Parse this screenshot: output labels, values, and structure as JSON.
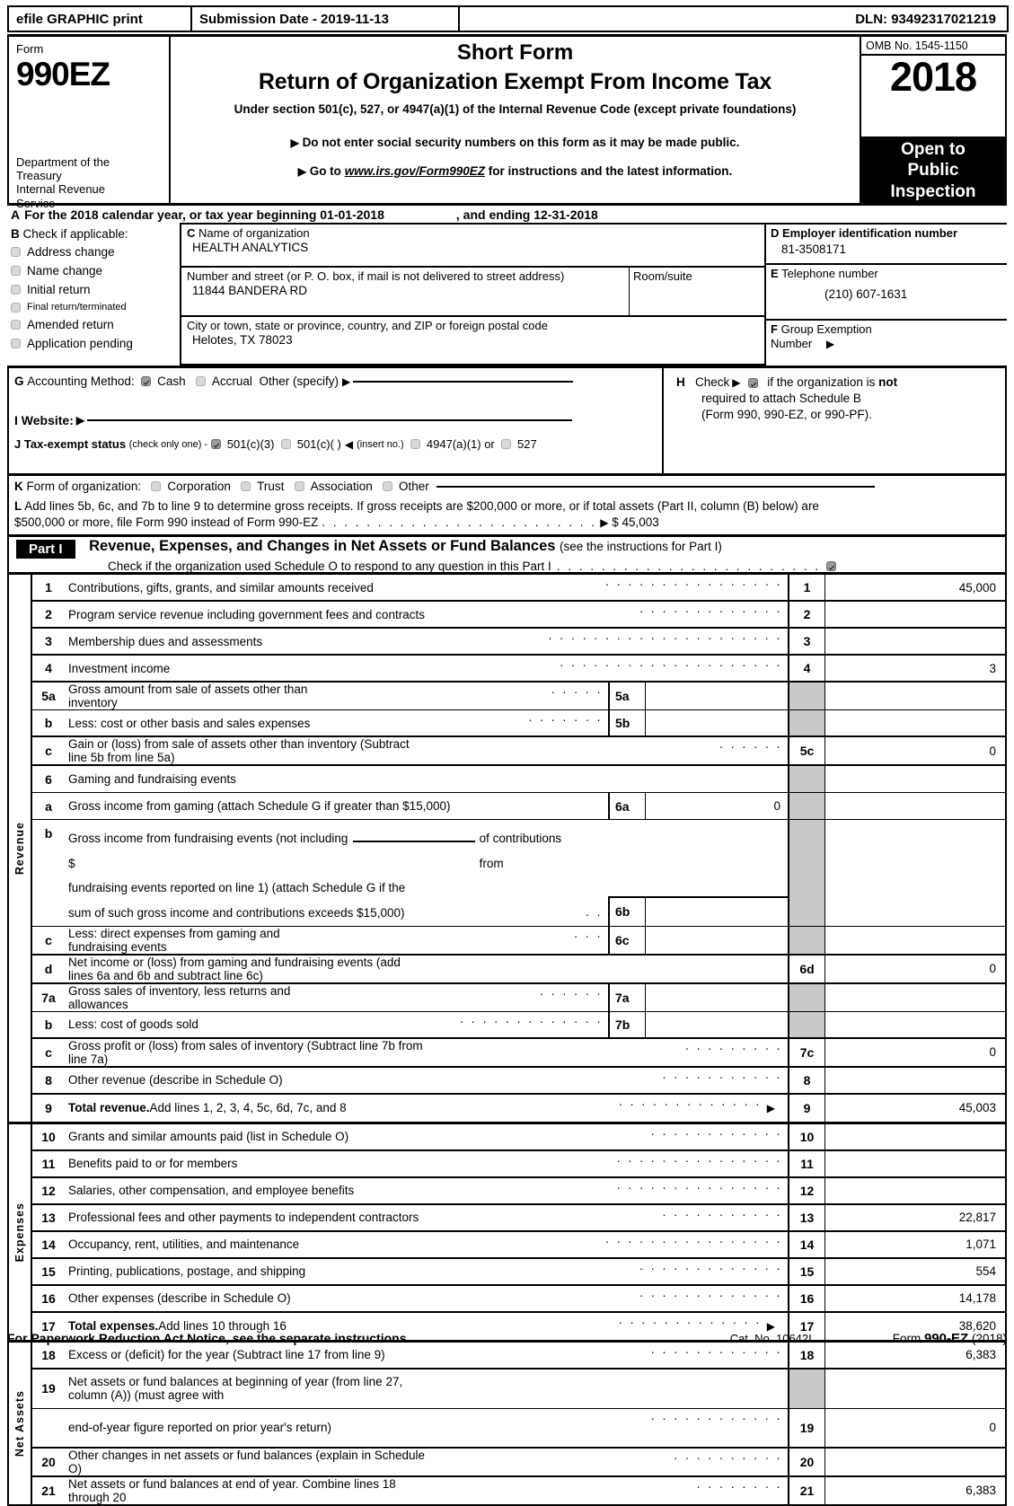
{
  "efile": {
    "graphic_print": "efile GRAPHIC print",
    "submission_date": "Submission Date - 2019-11-13",
    "dln": "DLN: 93492317021219"
  },
  "header": {
    "form_word": "Form",
    "form_number": "990EZ",
    "department": "Department of the Treasury Internal Revenue Service",
    "short_form": "Short Form",
    "title": "Return of Organization Exempt From Income Tax",
    "subtitle": "Under section 501(c), 527, or 4947(a)(1) of the Internal Revenue Code (except private foundations)",
    "note_ssn": "Do not enter social security numbers on this form as it may be made public.",
    "note_goto_prefix": "Go to",
    "note_goto_link": "www.irs.gov/Form990EZ",
    "note_goto_suffix": "for instructions and the latest information.",
    "omb": "OMB No. 1545-1150",
    "year": "2018",
    "open_to": "Open to",
    "public": "Public",
    "inspection": "Inspection"
  },
  "lineA": {
    "letter": "A",
    "text_before": "For the 2018 calendar year, or tax year beginning",
    "begin_date": "01-01-2018",
    "text_middle": ", and ending",
    "end_date": "12-31-2018"
  },
  "blockB": {
    "letter": "B",
    "heading": "Check if applicable:",
    "items": [
      {
        "label": "Address change",
        "checked": false
      },
      {
        "label": "Name change",
        "checked": false
      },
      {
        "label": "Initial return",
        "checked": false
      },
      {
        "label": "Final return/terminated",
        "checked": false
      },
      {
        "label": "Amended return",
        "checked": false
      },
      {
        "label": "Application pending",
        "checked": false
      }
    ]
  },
  "blockC": {
    "letter": "C",
    "name_label": "Name of organization",
    "name_value": "HEALTH ANALYTICS",
    "street_label": "Number and street (or P. O. box, if mail is not delivered to street address)",
    "street_value": "11844 BANDERA RD",
    "room_label": "Room/suite",
    "room_value": "",
    "city_label": "City or town, state or province, country, and ZIP or foreign postal code",
    "city_value": "Helotes, TX   78023"
  },
  "blockD": {
    "ein_letter": "D",
    "ein_label": "Employer identification number",
    "ein_value": "81-3508171",
    "tel_letter": "E",
    "tel_label": "Telephone number",
    "tel_value": "(210) 607-1631",
    "group_letter": "F",
    "group_label_1": "Group Exemption",
    "group_label_2": "Number",
    "group_value": ""
  },
  "lineG": {
    "letter": "G",
    "label": "Accounting Method:",
    "cash": "Cash",
    "cash_checked": true,
    "accrual": "Accrual",
    "accrual_checked": false,
    "other": "Other (specify)",
    "other_value": ""
  },
  "lineH": {
    "letter": "H",
    "text_1": "Check",
    "checked": true,
    "text_2": "if the organization is",
    "bold_not": "not",
    "text_3": "required to attach Schedule B",
    "text_4": "(Form 990, 990-EZ, or 990-PF)."
  },
  "lineI": {
    "letter": "I",
    "label": "Website:",
    "value": ""
  },
  "lineJ": {
    "letter": "J",
    "label": "Tax-exempt status",
    "note": "(check only one) -",
    "options": [
      {
        "label": "501(c)(3)",
        "checked": true
      },
      {
        "label": "501(c)(    )",
        "checked": false
      },
      {
        "label": "4947(a)(1) or",
        "checked": false
      },
      {
        "label": "527",
        "checked": false
      }
    ],
    "insert_no": "(insert no.)"
  },
  "lineK": {
    "letter": "K",
    "label": "Form of organization:",
    "options": [
      {
        "label": "Corporation",
        "checked": false
      },
      {
        "label": "Trust",
        "checked": false
      },
      {
        "label": "Association",
        "checked": false
      },
      {
        "label": "Other",
        "checked": false
      }
    ]
  },
  "lineL": {
    "letter": "L",
    "text_1": "Add lines 5b, 6c, and 7b to line 9 to determine gross receipts. If gross receipts are $200,000 or more, or if total assets (Part II, column (B) below) are",
    "text_2": "$500,000 or more, file Form 990 instead of Form 990-EZ",
    "amount": "$ 45,003"
  },
  "partI": {
    "badge": "Part I",
    "title": "Revenue, Expenses, and Changes in Net Assets or Fund Balances",
    "title_note": "(see the instructions for Part I)",
    "schedule_o_text": "Check if the organization used Schedule O to respond to any question in this Part I",
    "schedule_o_checked": true
  },
  "sections": [
    {
      "name": "Revenue",
      "rows": [
        {
          "num": "1",
          "text": "Contributions, gifts, grants, and similar amounts received",
          "dots": 17,
          "mn": "1",
          "mv": "45,000"
        },
        {
          "num": "2",
          "text": "Program service revenue including government fees and contracts",
          "dots": 14,
          "mn": "2",
          "mv": ""
        },
        {
          "num": "3",
          "text": "Membership dues and assessments",
          "dots": 22,
          "mn": "3",
          "mv": ""
        },
        {
          "num": "4",
          "text": "Investment income",
          "dots": 21,
          "mn": "4",
          "mv": "3"
        },
        {
          "num": "5a",
          "text": "Gross amount from sale of assets other than inventory",
          "dots": 5,
          "sn": "5a",
          "sv": "",
          "mn": "",
          "mv": "",
          "gray": true
        },
        {
          "num": "b",
          "text": "Less: cost or other basis and sales expenses",
          "dots": 7,
          "sn": "5b",
          "sv": "",
          "mn": "",
          "mv": "",
          "gray": true
        },
        {
          "num": "c",
          "text": "Gain or (loss) from sale of assets other than inventory (Subtract line 5b from line 5a)",
          "dots": 7,
          "mn": "5c",
          "mv": "0"
        },
        {
          "num": "6",
          "text": "Gaming and fundraising events",
          "dots": 0,
          "mn": "",
          "mv": "",
          "gray": true
        },
        {
          "num": "a",
          "text": "Gross income from gaming (attach Schedule G if greater than $15,000)",
          "dots": 0,
          "sn": "6a",
          "sv": "0",
          "mn": "",
          "mv": "",
          "gray": true
        },
        {
          "num": "b",
          "text": "Gross income from fundraising events (not including $ ________ of contributions from",
          "text2": "fundraising events reported on line 1) (attach Schedule G if the",
          "text3": "sum of such gross income and contributions exceeds $15,000)",
          "dots": 2,
          "sn": "6b",
          "sv": "",
          "mn": "",
          "mv": "",
          "gray": true,
          "tall": true
        },
        {
          "num": "c",
          "text": "Less: direct expenses from gaming and fundraising events",
          "dots": 3,
          "sn": "6c",
          "sv": "",
          "mn": "",
          "mv": "",
          "gray": true
        },
        {
          "num": "d",
          "text": "Net income or (loss) from gaming and fundraising events (add lines 6a and 6b and subtract line 6c)",
          "dots": 0,
          "mn": "6d",
          "mv": "0"
        },
        {
          "num": "7a",
          "text": "Gross sales of inventory, less returns and allowances",
          "dots": 6,
          "sn": "7a",
          "sv": "",
          "mn": "",
          "mv": "",
          "gray": true
        },
        {
          "num": "b",
          "text": "Less: cost of goods sold",
          "dots": 13,
          "sn": "7b",
          "sv": "",
          "mn": "",
          "mv": "",
          "gray": true
        },
        {
          "num": "c",
          "text": "Gross profit or (loss) from sales of inventory (Subtract line 7b from line 7a)",
          "dots": 10,
          "mn": "7c",
          "mv": "0"
        },
        {
          "num": "8",
          "text": "Other revenue (describe in Schedule O)",
          "dots": 11,
          "mn": "8",
          "mv": ""
        },
        {
          "num": "9",
          "text": "Total revenue.",
          "text_rest": " Add lines 1, 2, 3, 4, 5c, 6d, 7c, and 8",
          "dots": 13,
          "arrow": true,
          "mn": "9",
          "mv": "45,003",
          "bold": true
        }
      ]
    },
    {
      "name": "Expenses",
      "rows": [
        {
          "num": "10",
          "text": "Grants and similar amounts paid (list in Schedule O)",
          "dots": 12,
          "mn": "10",
          "mv": ""
        },
        {
          "num": "11",
          "text": "Benefits paid to or for members",
          "dots": 15,
          "mn": "11",
          "mv": ""
        },
        {
          "num": "12",
          "text": "Salaries, other compensation, and employee benefits",
          "dots": 15,
          "mn": "12",
          "mv": ""
        },
        {
          "num": "13",
          "text": "Professional fees and other payments to independent contractors",
          "dots": 12,
          "mn": "13",
          "mv": "22,817"
        },
        {
          "num": "14",
          "text": "Occupancy, rent, utilities, and maintenance",
          "dots": 16,
          "mn": "14",
          "mv": "1,071"
        },
        {
          "num": "15",
          "text": "Printing, publications, postage, and shipping",
          "dots": 13,
          "mn": "15",
          "mv": "554"
        },
        {
          "num": "16",
          "text": "Other expenses (describe in Schedule O)",
          "dots": 13,
          "mn": "16",
          "mv": "14,178"
        },
        {
          "num": "17",
          "text": "Total expenses.",
          "text_rest": " Add lines 10 through 16",
          "dots": 13,
          "arrow": true,
          "mn": "17",
          "mv": "38,620",
          "bold": true
        }
      ]
    },
    {
      "name": "Net Assets",
      "rows": [
        {
          "num": "18",
          "text": "Excess or (deficit) for the year (Subtract line 17 from line 9)",
          "dots": 12,
          "mn": "18",
          "mv": "6,383"
        },
        {
          "num": "19",
          "text": "Net assets or fund balances at beginning of year (from line 27, column (A)) (must agree with",
          "dots": 0,
          "mn": "",
          "mv": "",
          "gray": true
        },
        {
          "num": "",
          "text": "end-of-year figure reported on prior year's return",
          "text_close": ")",
          "dots": 12,
          "mn": "19",
          "mv": "0"
        },
        {
          "num": "20",
          "text": "Other changes in net assets or fund balances (explain in Schedule O)",
          "dots": 10,
          "mn": "20",
          "mv": ""
        },
        {
          "num": "21",
          "text": "Net assets or fund balances at end of year. Combine lines 18 through 20",
          "dots": 8,
          "mn": "21",
          "mv": "6,383"
        }
      ]
    }
  ],
  "footer": {
    "notice": "For Paperwork Reduction Act Notice, see the separate instructions.",
    "cat_no": "Cat. No. 10642I",
    "form_prefix": "Form ",
    "form_name": "990-EZ",
    "form_year": "(2018)"
  }
}
